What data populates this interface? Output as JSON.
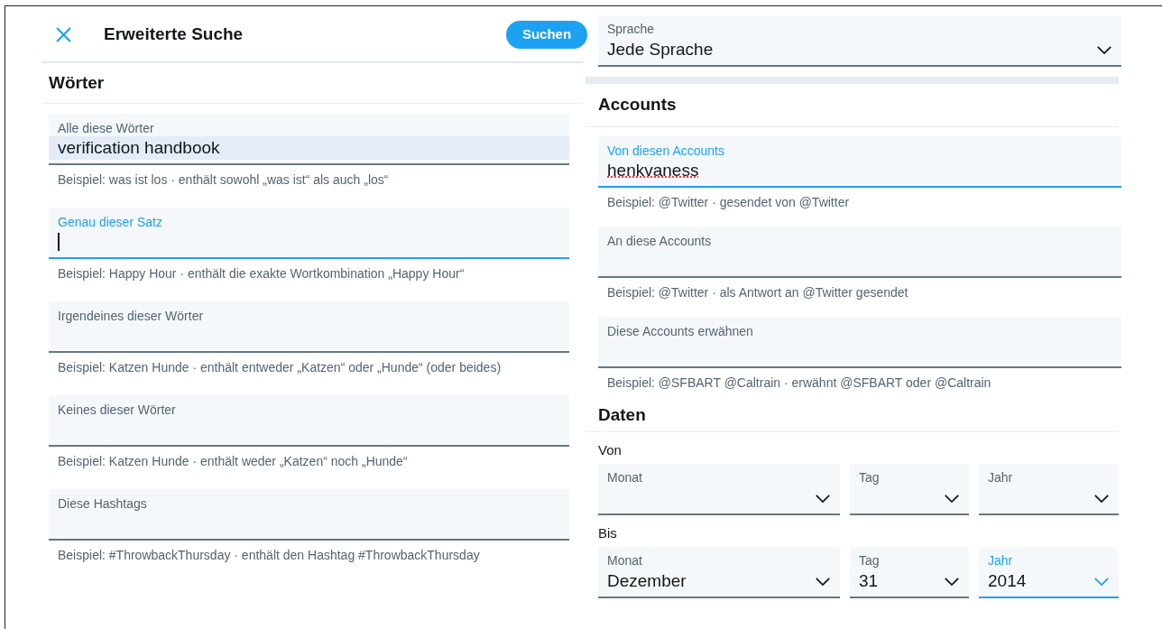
{
  "header": {
    "title": "Erweiterte Suche",
    "search_button": "Suchen"
  },
  "words": {
    "heading": "Wörter",
    "fields": [
      {
        "label": "Alle diese Wörter",
        "value": "verification handbook",
        "focused": false,
        "highlighted": true,
        "misspelled": false,
        "hint": "Beispiel: was ist los · enthält sowohl „was ist“ als auch „los“"
      },
      {
        "label": "Genau dieser Satz",
        "focused": true,
        "highlighted": false,
        "hint": "Beispiel: Happy Hour · enthält die exakte Wortkombination „Happy Hour“"
      },
      {
        "label": "Irgendeines dieser Wörter",
        "focused": false,
        "highlighted": false,
        "hint": "Beispiel: Katzen Hunde · enthält entweder „Katzen“ oder „Hunde“ (oder beides)"
      },
      {
        "label": "Keines dieser Wörter",
        "focused": false,
        "highlighted": false,
        "hint": "Beispiel: Katzen Hunde · enthält weder „Katzen“ noch „Hunde“"
      },
      {
        "label": "Diese Hashtags",
        "focused": false,
        "highlighted": false,
        "hint": "Beispiel: #ThrowbackThursday · enthält den Hashtag #ThrowbackThursday"
      }
    ]
  },
  "language": {
    "label": "Sprache",
    "value": "Jede Sprache",
    "focused": false
  },
  "accounts": {
    "heading": "Accounts",
    "fields": [
      {
        "label": "Von diesen Accounts",
        "value": "henkvaness",
        "focused": true,
        "highlighted": false,
        "misspelled": true,
        "hint": "Beispiel: @Twitter · gesendet von @Twitter"
      },
      {
        "label": "An diese Accounts",
        "focused": false,
        "highlighted": false,
        "hint": "Beispiel: @Twitter · als Antwort an @Twitter gesendet"
      },
      {
        "label": "Diese Accounts erwähnen",
        "focused": false,
        "highlighted": false,
        "hint": "Beispiel: @SFBART @Caltrain · erwähnt @SFBART oder @Caltrain"
      }
    ]
  },
  "dates": {
    "heading": "Daten",
    "ranges": [
      {
        "label": "Von",
        "selects": [
          {
            "label": "Monat",
            "focused": false
          },
          {
            "label": "Tag",
            "focused": false
          },
          {
            "label": "Jahr",
            "focused": false
          }
        ]
      },
      {
        "label": "Bis",
        "selects": [
          {
            "label": "Monat",
            "value": "Dezember",
            "focused": false
          },
          {
            "label": "Tag",
            "value": "31",
            "focused": false
          },
          {
            "label": "Jahr",
            "value": "2014",
            "focused": true
          }
        ]
      }
    ]
  }
}
